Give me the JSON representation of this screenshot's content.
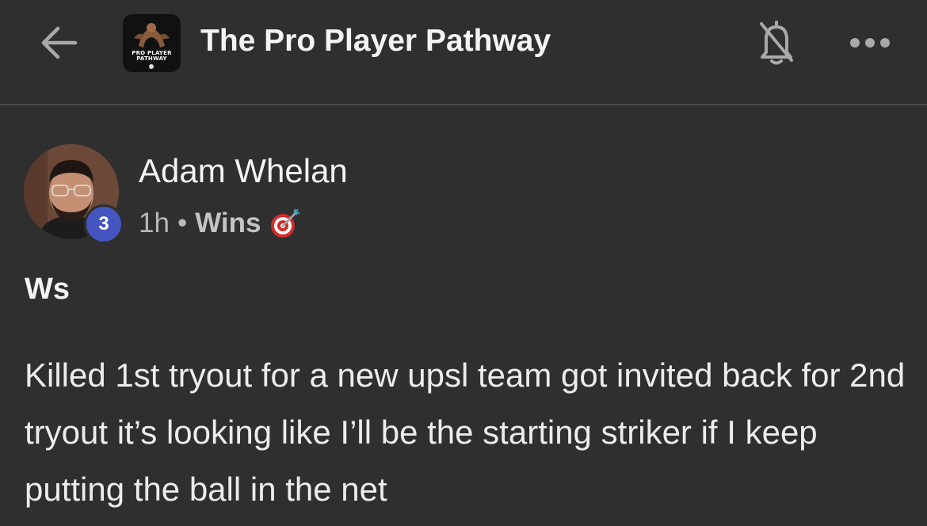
{
  "header": {
    "title": "The Pro Player Pathway",
    "logo_text": "PRO PLAYER PATHWAY",
    "back_icon": "arrow-left-icon",
    "bell_icon": "bell-off-icon",
    "more_icon": "more-horizontal-icon"
  },
  "post": {
    "author": "Adam Whelan",
    "level": "3",
    "time": "1h",
    "separator": "•",
    "category": "Wins",
    "category_icon": "target-dart-icon",
    "title": "Ws",
    "body": "Killed 1st tryout for a new upsl team got invited back for 2nd tryout it’s looking like I’ll be the starting striker if I keep putting the ball in the net"
  },
  "colors": {
    "background": "#2f2f30",
    "level_badge": "#4455c0",
    "text": "#f4f4f4",
    "muted": "#b9b9b9"
  }
}
